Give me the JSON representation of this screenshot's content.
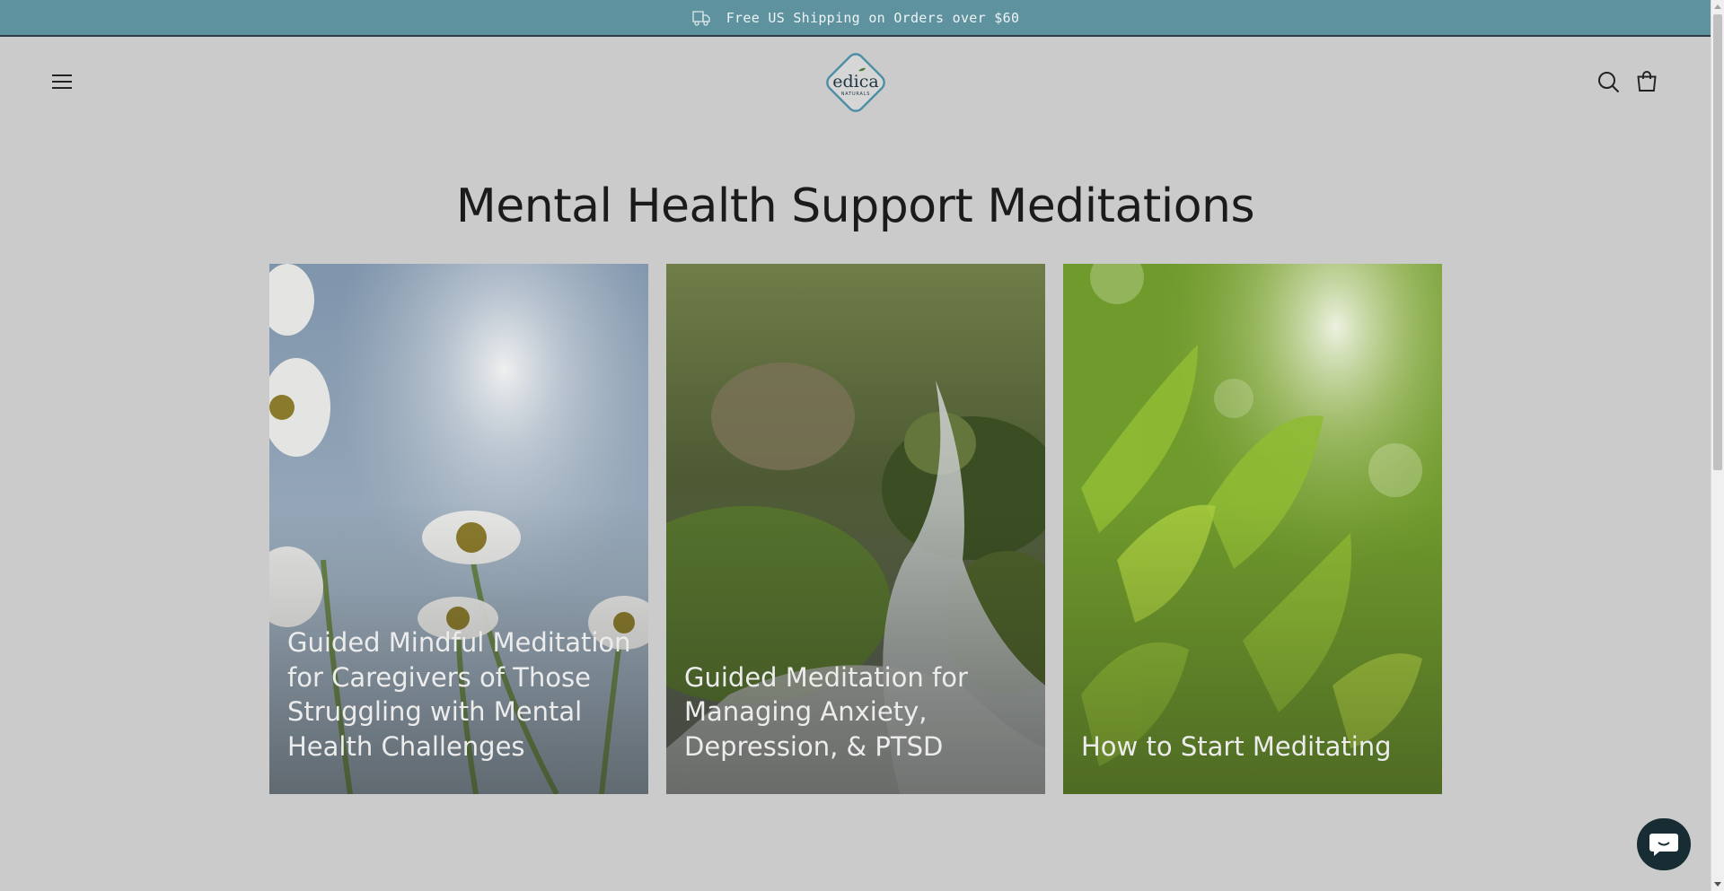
{
  "announcement": {
    "text": "Free US Shipping on Orders over $60",
    "icon": "truck-icon"
  },
  "header": {
    "logo_text": "edica",
    "logo_subtext": "NATURALS",
    "icons": [
      "menu-icon",
      "search-icon",
      "cart-icon"
    ]
  },
  "page": {
    "title": "Mental Health Support Meditations"
  },
  "cards": [
    {
      "title": "Guided Mindful Meditation for Caregivers of Those Struggling with Mental Health Challenges",
      "image": "daisies-sky"
    },
    {
      "title": "Guided Meditation for Managing Anxiety, Depression, & PTSD",
      "image": "mossy-waterfall"
    },
    {
      "title": "How to Start Meditating",
      "image": "green-leaves-sunlight"
    }
  ],
  "chat": {
    "icon": "chat-icon"
  },
  "colors": {
    "announcement_bg": "#5f929f",
    "page_bg": "#cbcbcb",
    "chat_bg": "#172d33",
    "logo_accent": "#4e8ea6"
  }
}
